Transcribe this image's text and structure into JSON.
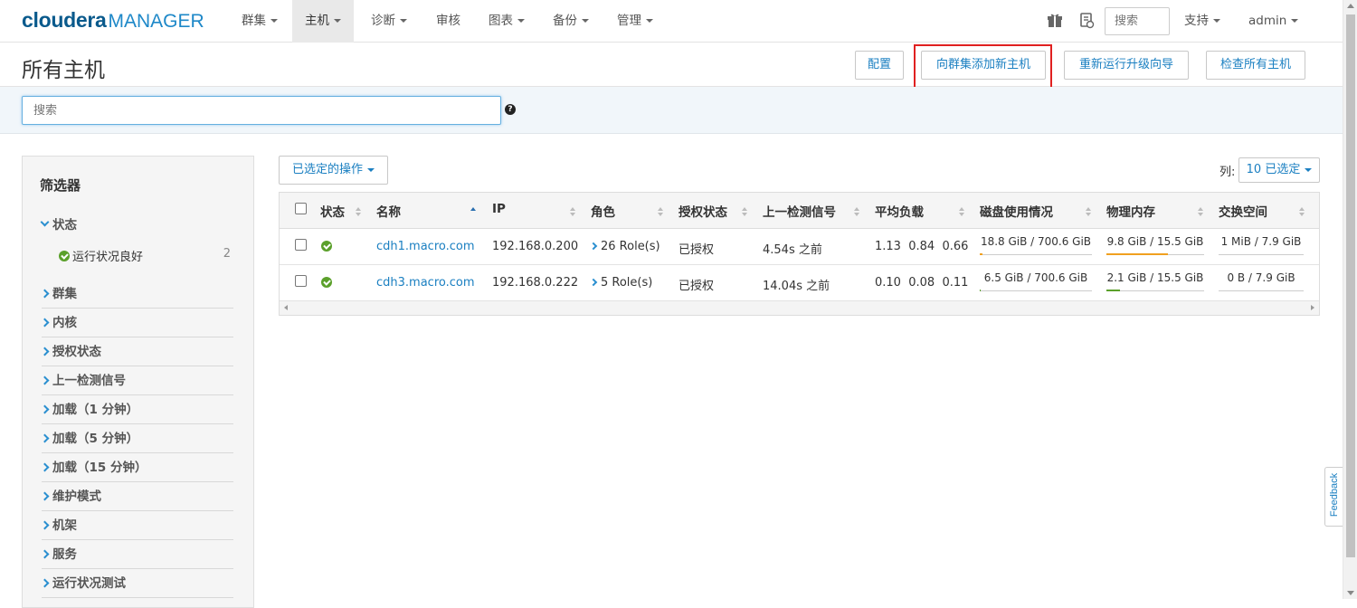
{
  "nav": {
    "logo_main": "cloudera",
    "logo_sub": "MANAGER",
    "items": [
      {
        "label": "群集",
        "caret": true
      },
      {
        "label": "主机",
        "caret": true,
        "active": true
      },
      {
        "label": "诊断",
        "caret": true
      },
      {
        "label": "审核",
        "caret": false
      },
      {
        "label": "图表",
        "caret": true
      },
      {
        "label": "备份",
        "caret": true
      },
      {
        "label": "管理",
        "caret": true
      }
    ],
    "search_placeholder": "搜索",
    "support_label": "支持",
    "user_label": "admin"
  },
  "page": {
    "title": "所有主机",
    "buttons": {
      "config": "配置",
      "add_host": "向群集添加新主机",
      "rerun_upgrade": "重新运行升级向导",
      "inspect_all": "检查所有主机"
    },
    "search_placeholder": "搜索"
  },
  "filters": {
    "title": "筛选器",
    "status_label": "状态",
    "status_sub": {
      "label": "运行状况良好",
      "count": "2"
    },
    "items": [
      "群集",
      "内核",
      "授权状态",
      "上一检测信号",
      "加载（1 分钟）",
      "加载（5 分钟）",
      "加载（15 分钟）",
      "维护模式",
      "机架",
      "服务",
      "运行状况测试"
    ]
  },
  "table": {
    "selected_ops": "已选定的操作",
    "columns_label": "列:",
    "columns_selected": "10 已选定",
    "headers": [
      "状态",
      "名称",
      "IP",
      "角色",
      "授权状态",
      "上一检测信号",
      "平均负载",
      "磁盘使用情况",
      "物理内存",
      "交换空间"
    ],
    "rows": [
      {
        "name": "cdh1.macro.com",
        "ip": "192.168.0.200",
        "roles": "26 Role(s)",
        "auth": "已授权",
        "heartbeat": "4.54s 之前",
        "load": [
          "1.13",
          "0.84",
          "0.66"
        ],
        "disk": {
          "text": "18.8 GiB / 700.6 GiB",
          "fraction": 0.027
        },
        "memory": {
          "text": "9.8 GiB / 15.5 GiB",
          "fraction": 0.63
        },
        "swap": {
          "text": "1 MiB / 7.9 GiB",
          "fraction": 0.0
        }
      },
      {
        "name": "cdh3.macro.com",
        "ip": "192.168.0.222",
        "roles": "5 Role(s)",
        "auth": "已授权",
        "heartbeat": "14.04s 之前",
        "load": [
          "0.10",
          "0.08",
          "0.11"
        ],
        "disk": {
          "text": "6.5 GiB / 700.6 GiB",
          "fraction": 0.01
        },
        "memory": {
          "text": "2.1 GiB / 15.5 GiB",
          "fraction": 0.135
        },
        "swap": {
          "text": "0 B / 7.9 GiB",
          "fraction": 0.0
        }
      }
    ]
  },
  "feedback_label": "Feedback",
  "colors": {
    "accent": "#1a7fc1",
    "ok": "#5ba02b",
    "memory_high": "#f0a020",
    "memory_low": "#5ba02b",
    "disk": "#f0a020"
  }
}
